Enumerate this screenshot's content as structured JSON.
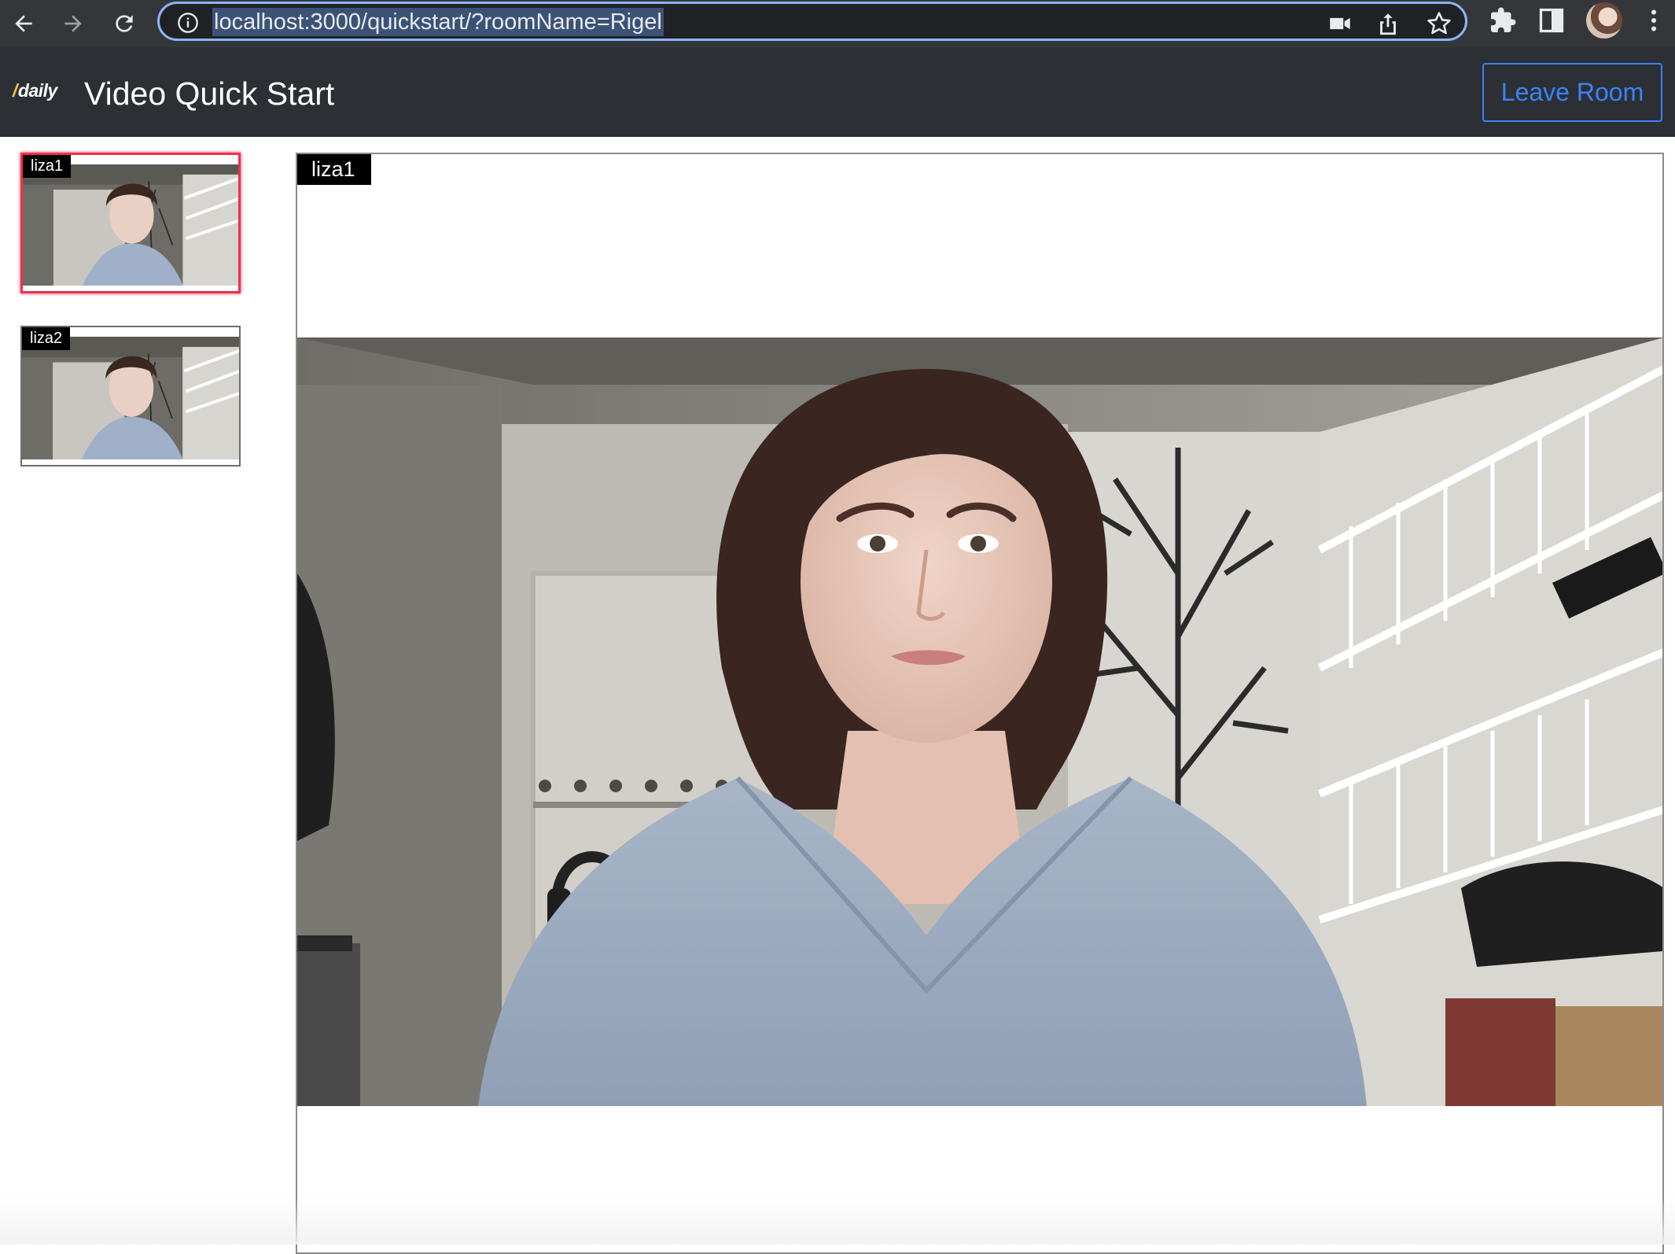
{
  "browser": {
    "url": "localhost:3000/quickstart/?roomName=Rigel",
    "icons": [
      "back-arrow-icon",
      "forward-arrow-icon",
      "reload-icon",
      "info-icon",
      "camera-icon",
      "share-icon",
      "star-icon",
      "extensions-icon",
      "side-panel-icon",
      "profile-avatar",
      "more-menu-icon"
    ]
  },
  "header": {
    "logo": "daily",
    "logo_slash": "/",
    "title": "Video Quick Start",
    "leave_button": "Leave Room"
  },
  "participants": [
    {
      "name": "liza1",
      "active": true
    },
    {
      "name": "liza2",
      "active": false
    }
  ],
  "main_video": {
    "name": "liza1"
  },
  "colors": {
    "browser_bar": "#35363a",
    "header_bg": "#2c3035",
    "accent_blue": "#3b82f6",
    "active_border": "#f0304d",
    "omnibox_focus": "#8ab4f8"
  }
}
